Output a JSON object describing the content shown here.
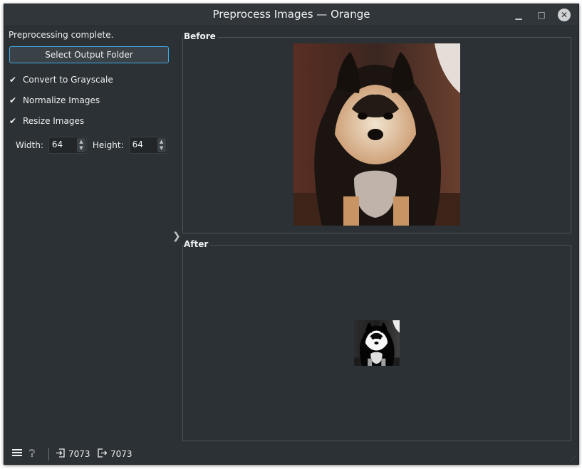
{
  "window": {
    "title": "Preprocess Images — Orange"
  },
  "controls": {
    "status": "Preprocessing complete.",
    "select_folder_label": "Select Output Folder",
    "checkboxes": [
      {
        "label": "Convert to Grayscale",
        "checked": true
      },
      {
        "label": "Normalize Images",
        "checked": true
      },
      {
        "label": "Resize Images",
        "checked": true
      }
    ],
    "width_label": "Width:",
    "width_value": "64",
    "height_label": "Height:",
    "height_value": "64"
  },
  "panels": {
    "before_label": "Before",
    "after_label": "After"
  },
  "statusbar": {
    "input_count": "7073",
    "output_count": "7073"
  },
  "icons": [
    "minimize-icon",
    "maximize-icon",
    "close-icon",
    "checkmark-icon",
    "splitter-arrow-icon",
    "menu-icon",
    "help-icon",
    "input-icon",
    "output-icon"
  ]
}
